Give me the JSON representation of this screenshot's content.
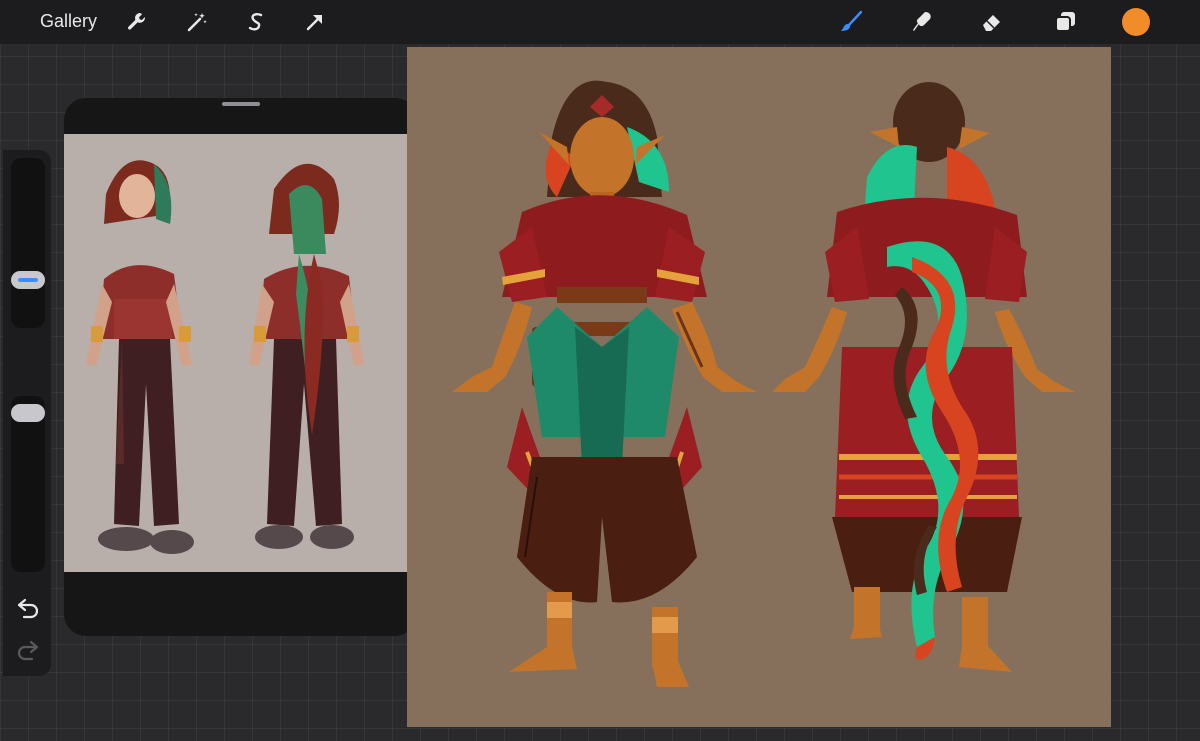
{
  "toolbar": {
    "gallery_label": "Gallery",
    "actions": [
      {
        "name": "wrench-icon"
      },
      {
        "name": "magic-wand-icon"
      },
      {
        "name": "selection-s-icon"
      },
      {
        "name": "transform-arrow-icon"
      }
    ],
    "tools": [
      {
        "name": "brush-icon",
        "active": true
      },
      {
        "name": "smudge-icon",
        "active": false
      },
      {
        "name": "eraser-icon",
        "active": false
      },
      {
        "name": "layers-icon",
        "active": false
      }
    ],
    "current_color": "#f28c28"
  },
  "sidebar": {
    "brush_size_fraction": 0.21,
    "opacity_fraction": 0.96,
    "modify_icon": "square-icon",
    "undo_icon": "undo-icon",
    "redo_icon": "redo-icon"
  },
  "colors": {
    "active_tool": "#3a8dff",
    "canvas_bg": "#86705b",
    "reference_bg": "#b8aeaa"
  }
}
